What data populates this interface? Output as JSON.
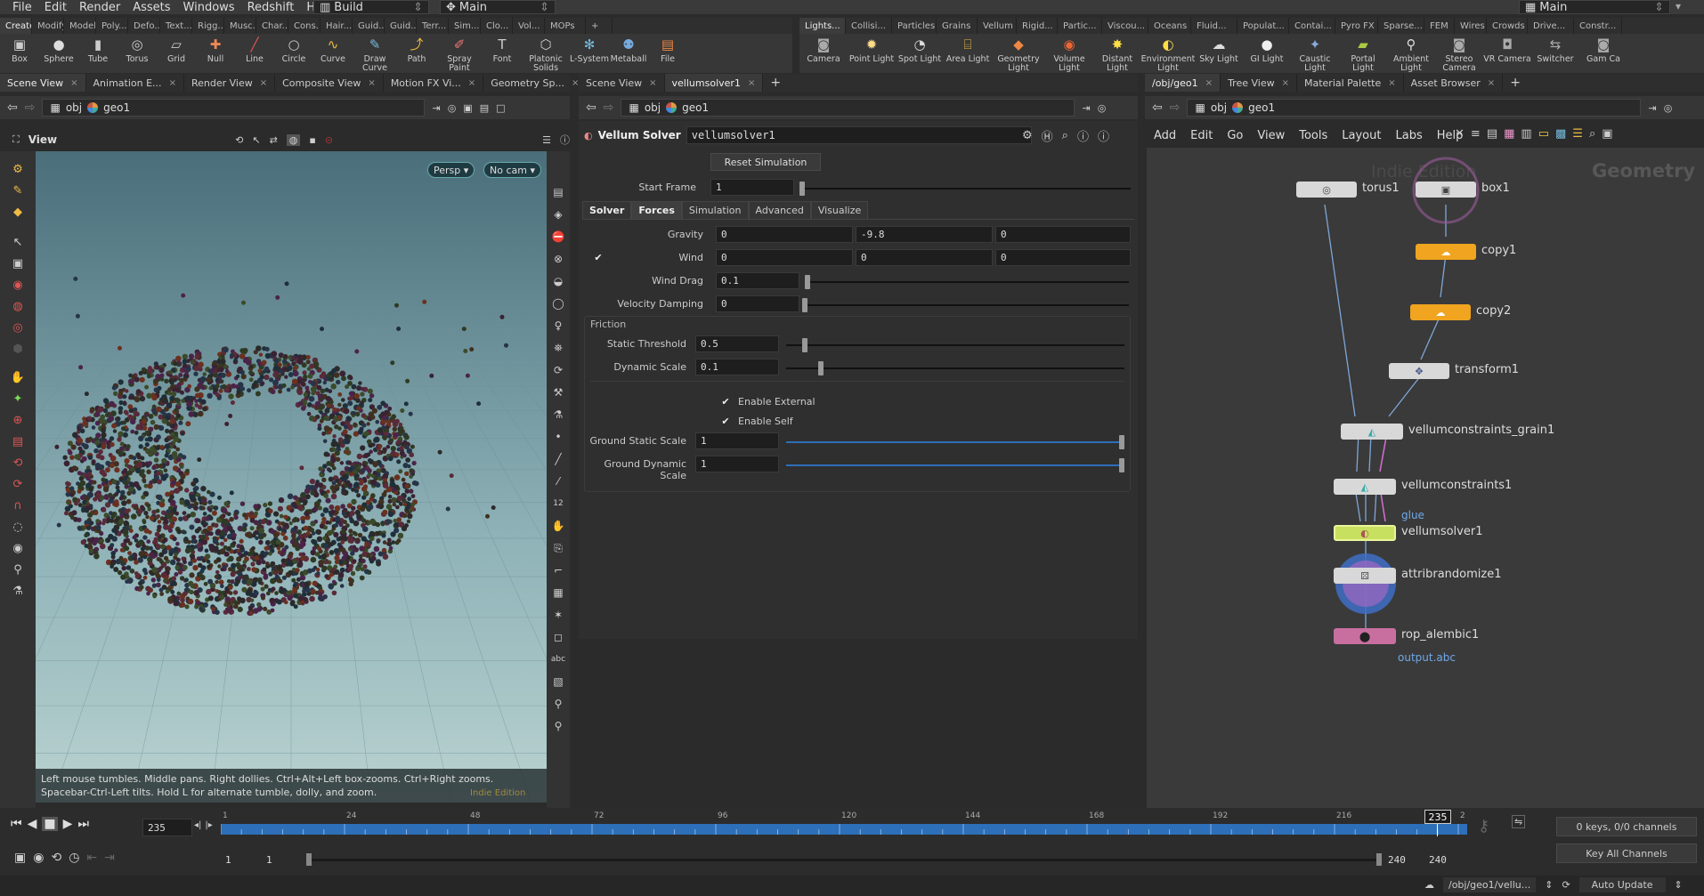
{
  "menu": [
    "File",
    "Edit",
    "Render",
    "Assets",
    "Windows",
    "Redshift",
    "Help"
  ],
  "desktop": {
    "build": "Build",
    "main": "Main",
    "right_main": "Main"
  },
  "shelf_left_tabs": [
    "Create",
    "Modify",
    "Model",
    "Poly...",
    "Defo...",
    "Text...",
    "Rigg...",
    "Musc...",
    "Char...",
    "Cons...",
    "Hair...",
    "Guid...",
    "Guid...",
    "Terr...",
    "Sim...",
    "Clo...",
    "Vol...",
    "MOPs"
  ],
  "shelf_right_tabs": [
    "Lights...",
    "Collisi...",
    "Particles",
    "Grains",
    "Vellum",
    "Rigid...",
    "Partic...",
    "Viscou...",
    "Oceans",
    "Fluid...",
    "Populat...",
    "Contai...",
    "Pyro FX",
    "Sparse...",
    "FEM",
    "Wires",
    "Crowds",
    "Drive...",
    "Constr..."
  ],
  "shelf_left_tools": [
    {
      "label": "Box",
      "icon": "▣"
    },
    {
      "label": "Sphere",
      "icon": "●"
    },
    {
      "label": "Tube",
      "icon": "▮"
    },
    {
      "label": "Torus",
      "icon": "◎"
    },
    {
      "label": "Grid",
      "icon": "▱"
    },
    {
      "label": "Null",
      "icon": "✚"
    },
    {
      "label": "Line",
      "icon": "╱"
    },
    {
      "label": "Circle",
      "icon": "○"
    },
    {
      "label": "Curve",
      "icon": "∿"
    },
    {
      "label": "Draw Curve",
      "icon": "✎"
    },
    {
      "label": "Path",
      "icon": "⤴"
    },
    {
      "label": "Spray Paint",
      "icon": "✐"
    },
    {
      "label": "Font",
      "icon": "T"
    },
    {
      "label": "Platonic Solids",
      "icon": "⬡"
    },
    {
      "label": "L-System",
      "icon": "✻"
    },
    {
      "label": "Metaball",
      "icon": "⚉"
    },
    {
      "label": "File",
      "icon": "▤"
    }
  ],
  "shelf_right_tools": [
    {
      "label": "Camera",
      "icon": "◙"
    },
    {
      "label": "Point Light",
      "icon": "✹"
    },
    {
      "label": "Spot Light",
      "icon": "◔"
    },
    {
      "label": "Area Light",
      "icon": "⌸"
    },
    {
      "label": "Geometry Light",
      "icon": "◆"
    },
    {
      "label": "Volume Light",
      "icon": "◉"
    },
    {
      "label": "Distant Light",
      "icon": "✸"
    },
    {
      "label": "Environment Light",
      "icon": "◐"
    },
    {
      "label": "Sky Light",
      "icon": "☁"
    },
    {
      "label": "GI Light",
      "icon": "●"
    },
    {
      "label": "Caustic Light",
      "icon": "✦"
    },
    {
      "label": "Portal Light",
      "icon": "▰"
    },
    {
      "label": "Ambient Light",
      "icon": "⚲"
    },
    {
      "label": "Stereo Camera",
      "icon": "◙"
    },
    {
      "label": "VR Camera",
      "icon": "◘"
    },
    {
      "label": "Switcher",
      "icon": "⇆"
    },
    {
      "label": "Gam Ca",
      "icon": "◙"
    }
  ],
  "left_pane": {
    "tabs": [
      "Scene View",
      "Animation E...",
      "Render View",
      "Composite View",
      "Motion FX Vi...",
      "Geometry Sp..."
    ],
    "path": {
      "root": "obj",
      "node": "geo1"
    },
    "view_label": "View",
    "persp": "Persp ▾",
    "cam": "No cam ▾",
    "hint": "Left mouse tumbles. Middle pans. Right dollies. Ctrl+Alt+Left box-zooms. Ctrl+Right zooms. Spacebar-Ctrl-Left tilts. Hold L for alternate tumble, dolly, and zoom.",
    "watermark": "Indie Edition"
  },
  "mid_pane": {
    "tabs": [
      "Scene View",
      "vellumsolver1"
    ],
    "path": {
      "root": "obj",
      "node": "geo1"
    },
    "node_type": "Vellum Solver",
    "node_name": "vellumsolver1",
    "reset_button": "Reset Simulation",
    "start_frame_label": "Start Frame",
    "start_frame": "1",
    "tabs2": [
      "Solver",
      "Forces",
      "Simulation",
      "Advanced",
      "Visualize"
    ],
    "gravity_label": "Gravity",
    "gravity": [
      "0",
      "-9.8",
      "0"
    ],
    "wind_label": "Wind",
    "wind": [
      "0",
      "0",
      "0"
    ],
    "wind_drag_label": "Wind Drag",
    "wind_drag": "0.1",
    "vel_damp_label": "Velocity Damping",
    "vel_damp": "0",
    "friction_label": "Friction",
    "static_threshold_label": "Static Threshold",
    "static_threshold": "0.5",
    "dynamic_scale_label": "Dynamic Scale",
    "dynamic_scale": "0.1",
    "enable_external": "Enable External",
    "enable_self": "Enable Self",
    "ground_static_label": "Ground Static Scale",
    "ground_static": "1",
    "ground_dynamic_label": "Ground Dynamic Scale",
    "ground_dynamic": "1"
  },
  "right_pane": {
    "tabs": [
      "/obj/geo1",
      "Tree View",
      "Material Palette",
      "Asset Browser"
    ],
    "path": {
      "root": "obj",
      "node": "geo1"
    },
    "menu": [
      "Add",
      "Edit",
      "Go",
      "View",
      "Tools",
      "Layout",
      "Labs",
      "Help"
    ],
    "watermark": "Indie Edition",
    "context": "Geometry",
    "nodes": {
      "torus1": "torus1",
      "box1": "box1",
      "copy1": "copy1",
      "copy2": "copy2",
      "transform1": "transform1",
      "vcg": "vellumconstraints_grain1",
      "vc1": "vellumconstraints1",
      "glue": "glue",
      "vs1": "vellumsolver1",
      "arand": "attribrandomize1",
      "rop": "rop_alembic1",
      "output": "output.abc"
    }
  },
  "timeline": {
    "frame": "235",
    "marker": "235",
    "ticks": [
      "1",
      "24",
      "48",
      "72",
      "96",
      "120",
      "144",
      "168",
      "192",
      "216",
      "2"
    ],
    "range_start": "1",
    "range_start2": "1",
    "range_end": "240",
    "range_end2": "240",
    "keys": "0 keys, 0/0 channels",
    "key_all": "Key All Channels"
  },
  "status": {
    "path": "/obj/geo1/vellu...",
    "update": "Auto Update"
  },
  "colors": {
    "accent": "#2d6fb8",
    "copy_node": "#f0a420",
    "rop_node": "#c86fa0",
    "selected_node": "#c8e060"
  }
}
